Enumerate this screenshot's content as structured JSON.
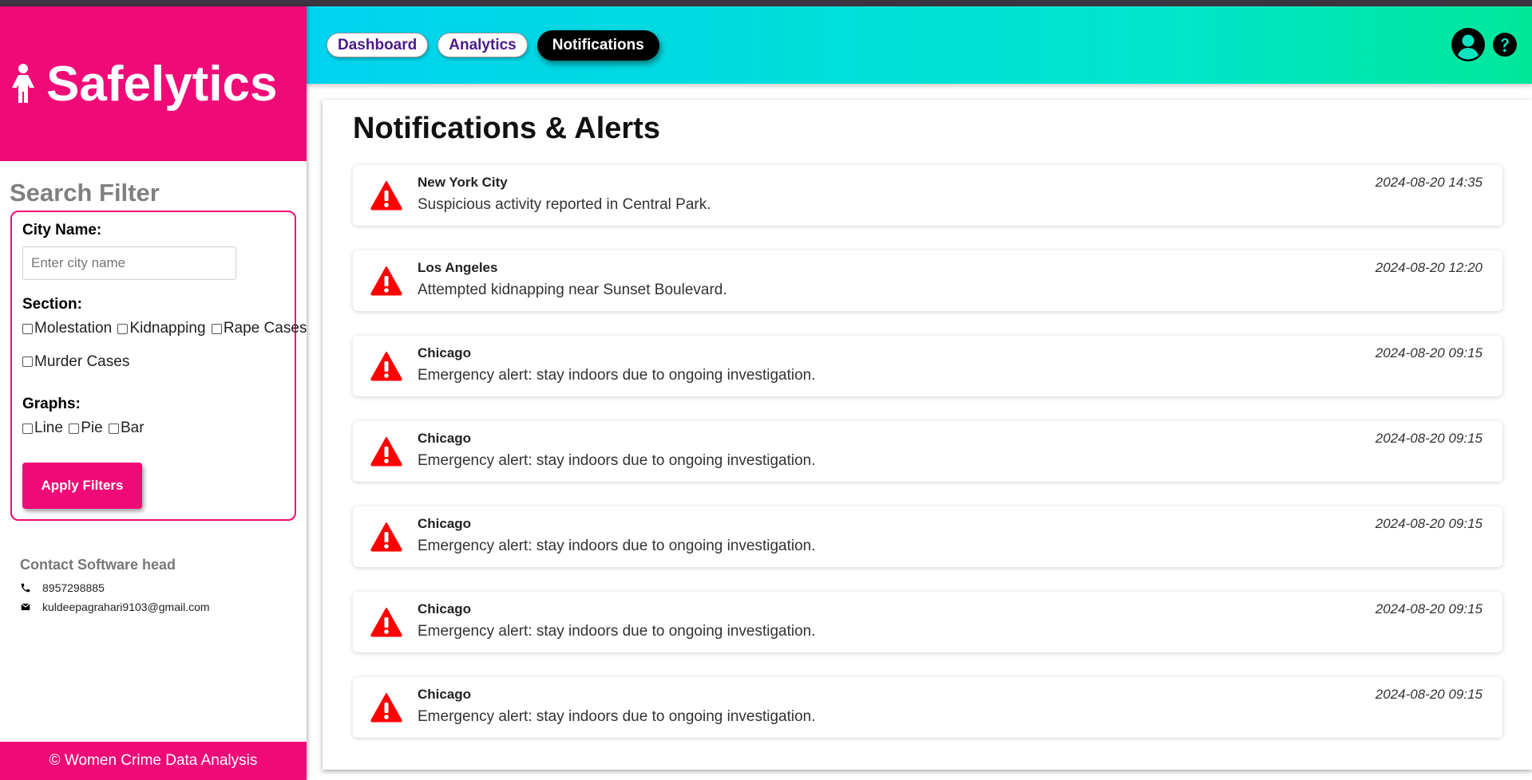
{
  "brand": {
    "name": "Safelytics",
    "icon": "woman-icon",
    "color": "#f00a78"
  },
  "sidebar": {
    "filter_title": "Search Filter",
    "city_label": "City Name:",
    "city_placeholder": "Enter city name",
    "city_value": "",
    "section_label": "Section:",
    "sections": [
      "Molestation",
      "Kidnapping",
      "Rape Cases",
      "Murder Cases"
    ],
    "graphs_label": "Graphs:",
    "graphs": [
      "Line",
      "Pie",
      "Bar"
    ],
    "apply_label": "Apply Filters",
    "contact": {
      "title": "Contact Software head",
      "phone": "8957298885",
      "email": "kuldeepagrahari9103@gmail.com"
    },
    "footer": "© Women Crime Data Analysis"
  },
  "topbar": {
    "tabs": [
      {
        "label": "Dashboard",
        "active": false
      },
      {
        "label": "Analytics",
        "active": false
      },
      {
        "label": "Notifications",
        "active": true
      }
    ],
    "icons": [
      "user-avatar-icon",
      "help-icon"
    ]
  },
  "main": {
    "title": "Notifications & Alerts",
    "notifications": [
      {
        "city": "New York City",
        "message": "Suspicious activity reported in Central Park.",
        "time": "2024-08-20 14:35"
      },
      {
        "city": "Los Angeles",
        "message": "Attempted kidnapping near Sunset Boulevard.",
        "time": "2024-08-20 12:20"
      },
      {
        "city": "Chicago",
        "message": "Emergency alert: stay indoors due to ongoing investigation.",
        "time": "2024-08-20 09:15"
      },
      {
        "city": "Chicago",
        "message": "Emergency alert: stay indoors due to ongoing investigation.",
        "time": "2024-08-20 09:15"
      },
      {
        "city": "Chicago",
        "message": "Emergency alert: stay indoors due to ongoing investigation.",
        "time": "2024-08-20 09:15"
      },
      {
        "city": "Chicago",
        "message": "Emergency alert: stay indoors due to ongoing investigation.",
        "time": "2024-08-20 09:15"
      },
      {
        "city": "Chicago",
        "message": "Emergency alert: stay indoors due to ongoing investigation.",
        "time": "2024-08-20 09:15"
      }
    ]
  },
  "colors": {
    "accent": "#f00a78",
    "alert": "#ff0000",
    "nav_text": "#4a1a8c"
  }
}
